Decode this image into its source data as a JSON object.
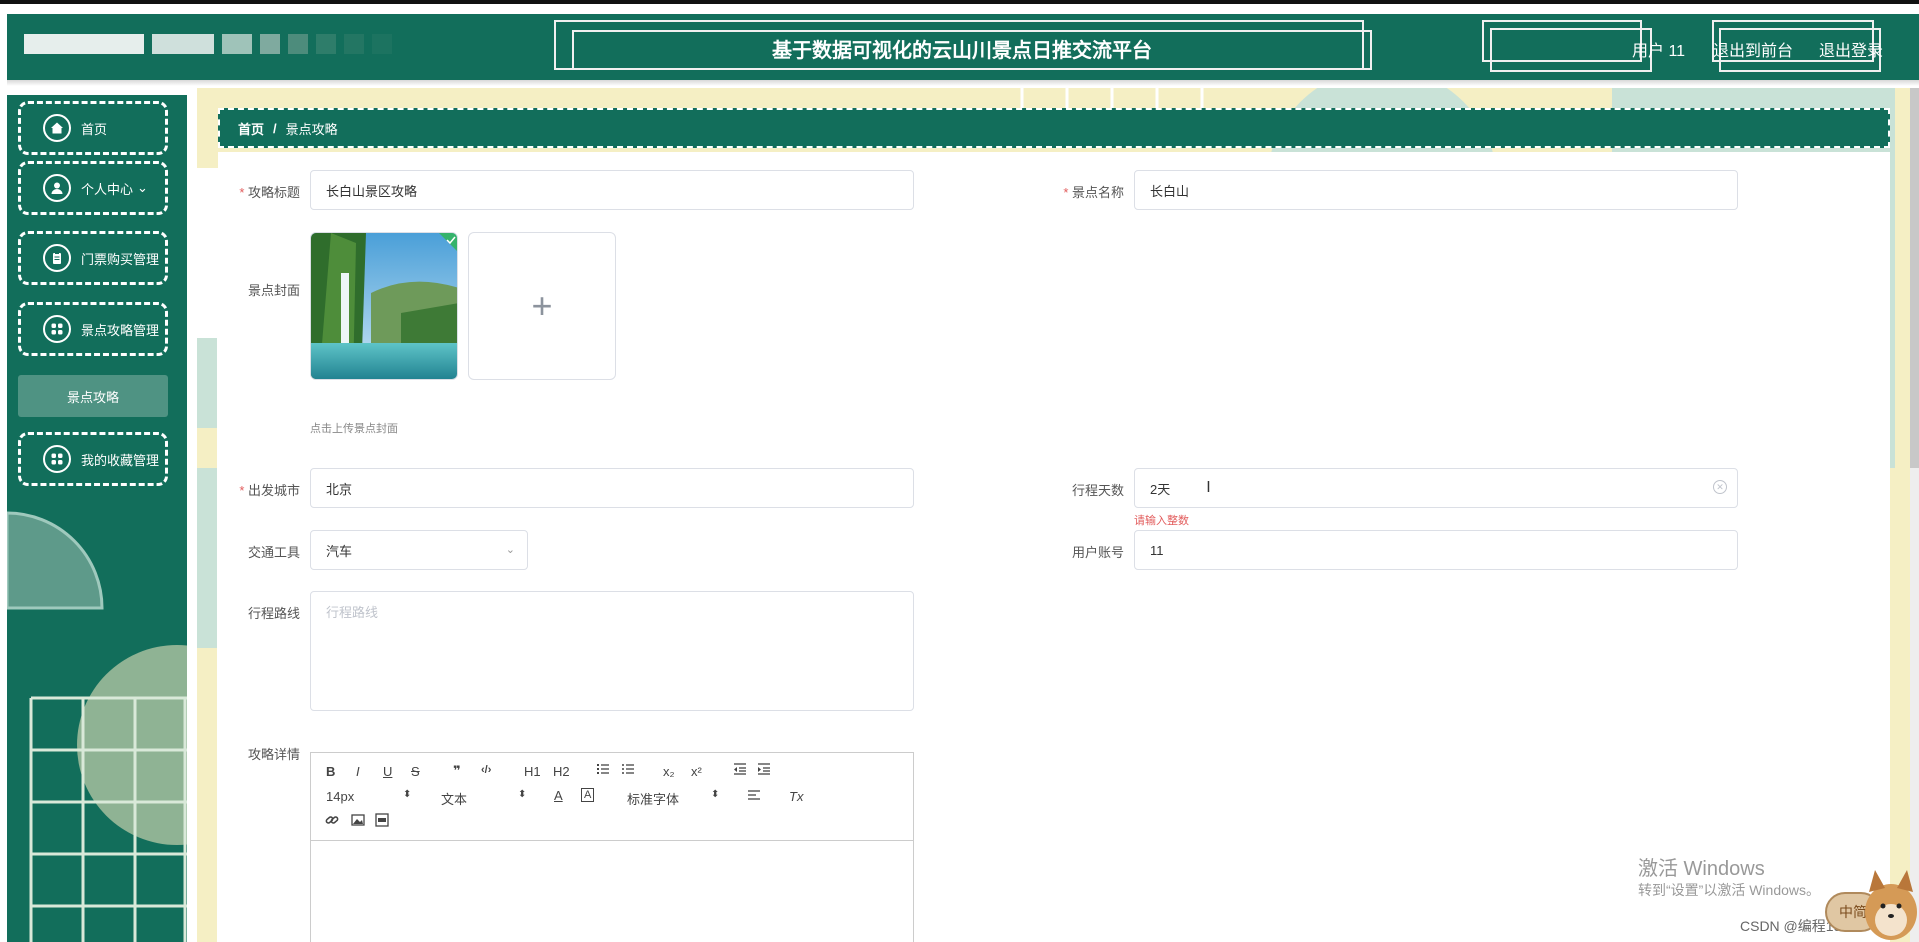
{
  "header": {
    "title": "基于数据可视化的云山川景点日推交流平台",
    "user": "用户 11",
    "back_link": "退出到前台",
    "logout_link": "退出登录"
  },
  "sidebar": {
    "items": [
      {
        "label": "首页",
        "icon": "home-icon"
      },
      {
        "label": "个人中心",
        "icon": "user-icon",
        "arrow": "⌄"
      },
      {
        "label": "门票购买管理",
        "icon": "clipboard-icon"
      },
      {
        "label": "景点攻略管理",
        "icon": "grid-icon"
      },
      {
        "label": "我的收藏管理",
        "icon": "grid-icon"
      }
    ],
    "sub_item": "景点攻略"
  },
  "breadcrumb": {
    "home": "首页",
    "sep": "/",
    "current": "景点攻略"
  },
  "form": {
    "title_label": "攻略标题",
    "title_value": "长白山景区攻略",
    "spot_label": "景点名称",
    "spot_value": "长白山",
    "cover_label": "景点封面",
    "upload_plus": "+",
    "upload_hint": "点击上传景点封面",
    "city_label": "出发城市",
    "city_value": "北京",
    "days_label": "行程天数",
    "days_value": "2天",
    "days_error": "请输入整数",
    "transport_label": "交通工具",
    "transport_value": "汽车",
    "account_label": "用户账号",
    "account_value": "11",
    "route_label": "行程路线",
    "route_placeholder": "行程路线",
    "detail_label": "攻略详情"
  },
  "editor": {
    "bold": "B",
    "italic": "I",
    "underline": "U",
    "strike": "S",
    "quote": "❞",
    "code": "‹/›",
    "h1": "H1",
    "h2": "H2",
    "sub": "x₂",
    "sup": "x²",
    "size": "14px",
    "format": "文本",
    "font": "标准字体",
    "clear": "Tx"
  },
  "watermark": {
    "line1": "激活 Windows",
    "line2": "转到“设置”以激活 Windows。",
    "csdn": "CSDN @编程1990",
    "badge": "中简"
  },
  "colors": {
    "primary": "#126e5b",
    "accent_cream": "#f5efc4",
    "accent_mint": "#c9e2d7"
  }
}
